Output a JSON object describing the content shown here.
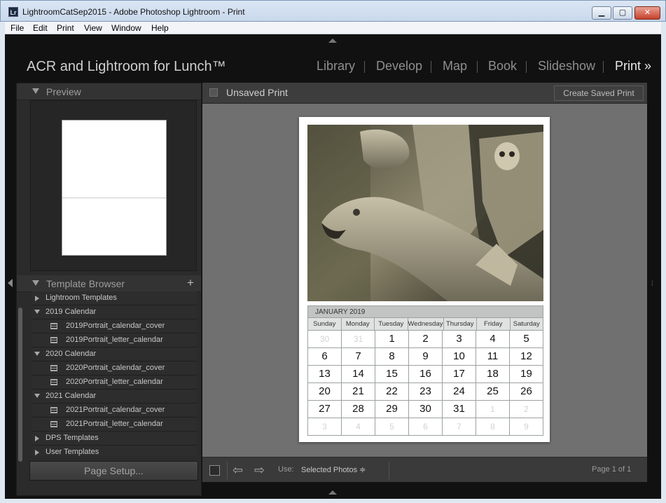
{
  "window": {
    "icon_label": "Lr",
    "title": "LightroomCatSep2015 - Adobe Photoshop Lightroom - Print",
    "minimize_glyph": "▁",
    "maximize_glyph": "▢",
    "close_glyph": "✕"
  },
  "menubar": [
    "File",
    "Edit",
    "Print",
    "View",
    "Window",
    "Help"
  ],
  "identity_plate": "ACR and Lightroom for Lunch™",
  "modules": [
    "Library",
    "Develop",
    "Map",
    "Book",
    "Slideshow",
    "Print"
  ],
  "active_module": "Print",
  "active_module_glyph": "»",
  "left_panel": {
    "preview_title": "Preview",
    "template_browser_title": "Template Browser",
    "add_glyph": "+",
    "templates": [
      {
        "label": "Lightroom Templates",
        "level": 0,
        "expanded": false
      },
      {
        "label": "2019 Calendar",
        "level": 0,
        "expanded": true
      },
      {
        "label": "2019Portrait_calendar_cover",
        "level": 1
      },
      {
        "label": "2019Portrait_letter_calendar",
        "level": 1
      },
      {
        "label": "2020 Calendar",
        "level": 0,
        "expanded": true
      },
      {
        "label": "2020Portrait_calendar_cover",
        "level": 1
      },
      {
        "label": "2020Portrait_letter_calendar",
        "level": 1
      },
      {
        "label": "2021 Calendar",
        "level": 0,
        "expanded": true
      },
      {
        "label": "2021Portrait_calendar_cover",
        "level": 1
      },
      {
        "label": "2021Portrait_letter_calendar",
        "level": 1
      },
      {
        "label": "DPS Templates",
        "level": 0,
        "expanded": false
      },
      {
        "label": "User Templates",
        "level": 0,
        "expanded": false
      }
    ],
    "page_setup_label": "Page Setup..."
  },
  "center": {
    "title": "Unsaved Print",
    "create_saved_print_label": "Create Saved Print"
  },
  "calendar": {
    "month": "JANUARY 2019",
    "days": [
      "Sunday",
      "Monday",
      "Tuesday",
      "Wednesday",
      "Thursday",
      "Friday",
      "Saturday"
    ],
    "weeks": [
      [
        {
          "d": "30",
          "dim": true
        },
        {
          "d": "31",
          "dim": true
        },
        {
          "d": "1"
        },
        {
          "d": "2"
        },
        {
          "d": "3"
        },
        {
          "d": "4"
        },
        {
          "d": "5"
        }
      ],
      [
        {
          "d": "6"
        },
        {
          "d": "7"
        },
        {
          "d": "8"
        },
        {
          "d": "9"
        },
        {
          "d": "10"
        },
        {
          "d": "11"
        },
        {
          "d": "12"
        }
      ],
      [
        {
          "d": "13"
        },
        {
          "d": "14"
        },
        {
          "d": "15"
        },
        {
          "d": "16"
        },
        {
          "d": "17"
        },
        {
          "d": "18"
        },
        {
          "d": "19"
        }
      ],
      [
        {
          "d": "20"
        },
        {
          "d": "21"
        },
        {
          "d": "22"
        },
        {
          "d": "23"
        },
        {
          "d": "24"
        },
        {
          "d": "25"
        },
        {
          "d": "26"
        }
      ],
      [
        {
          "d": "27"
        },
        {
          "d": "28"
        },
        {
          "d": "29"
        },
        {
          "d": "30"
        },
        {
          "d": "31"
        },
        {
          "d": "1",
          "dim": true
        },
        {
          "d": "2",
          "dim": true
        }
      ],
      [
        {
          "d": "3",
          "dim": true
        },
        {
          "d": "4",
          "dim": true
        },
        {
          "d": "5",
          "dim": true
        },
        {
          "d": "6",
          "dim": true
        },
        {
          "d": "7",
          "dim": true
        },
        {
          "d": "8",
          "dim": true
        },
        {
          "d": "9",
          "dim": true
        }
      ]
    ]
  },
  "toolbar": {
    "prev_glyph": "⇦",
    "next_glyph": "⇨",
    "use_label": "Use:",
    "use_value": "Selected Photos ≑",
    "page_info": "Page 1 of 1"
  },
  "icons": {
    "photo": "gargoyle-photo",
    "print": "print-icon",
    "template": "template-icon"
  },
  "colors": {
    "app_bg": "#111111",
    "panel_bg": "#2b2b2b",
    "canvas_bg": "#707070",
    "active_module": "#e8e8e8",
    "inactive_module": "#8f8f8f"
  }
}
